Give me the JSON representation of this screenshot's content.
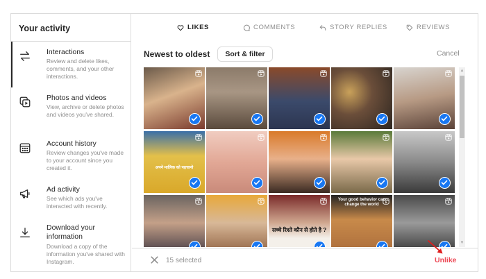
{
  "sidebar": {
    "title": "Your activity",
    "items": [
      {
        "label": "Interactions",
        "description": "Review and delete likes, comments, and your other interactions.",
        "icon": "interactions-icon"
      },
      {
        "label": "Photos and videos",
        "description": "View, archive or delete photos and videos you've shared.",
        "icon": "photos-icon"
      },
      {
        "label": "Account history",
        "description": "Review changes you've made to your account since you created it.",
        "icon": "calendar-icon"
      },
      {
        "label": "Ad activity",
        "description": "See which ads you've interacted with recently.",
        "icon": "megaphone-icon"
      },
      {
        "label": "Download your information",
        "description": "Download a copy of the information you've shared with Instagram.",
        "icon": "download-icon"
      }
    ]
  },
  "tabs": [
    {
      "label": "LIKES",
      "icon": "heart-icon",
      "active": true
    },
    {
      "label": "COMMENTS",
      "icon": "comment-icon",
      "active": false
    },
    {
      "label": "STORY REPLIES",
      "icon": "reply-icon",
      "active": false
    },
    {
      "label": "REVIEWS",
      "icon": "tag-icon",
      "active": false
    }
  ],
  "toolbar": {
    "sort_title": "Newest to oldest",
    "sort_button": "Sort & filter",
    "cancel": "Cancel"
  },
  "tiles": [
    {
      "bg": "linear-gradient(160deg,#6b5a4a 0%,#d9b38c 45%,#7a3b2e 100%)",
      "selected": true,
      "caption": ""
    },
    {
      "bg": "linear-gradient(180deg,#8c7b6a 0%,#a89684 40%,#5a4a3c 100%)",
      "selected": true,
      "caption": ""
    },
    {
      "bg": "linear-gradient(180deg,#8a4a2a 0%,#3b4a6b 55%,#2c3550 100%)",
      "selected": true,
      "caption": ""
    },
    {
      "bg": "radial-gradient(circle at 30% 40%,#c9a15a 0%,#6b4e3a 40%,#2d2620 100%)",
      "selected": true,
      "caption": ""
    },
    {
      "bg": "linear-gradient(170deg,#d8d4cf 0%,#b79a84 50%,#5a4238 100%)",
      "selected": true,
      "caption": ""
    },
    {
      "bg": "linear-gradient(180deg,#3a6fa8 0%,#e3c04a 40%,#d9a82a 100%)",
      "selected": true,
      "caption": "अपने मालिक को पहचानो"
    },
    {
      "bg": "linear-gradient(180deg,#f0ccc0 0%,#e2a896 50%,#c98a7a 100%)",
      "selected": true,
      "caption": ""
    },
    {
      "bg": "linear-gradient(180deg,#d97a2a 0%,#e8b08a 45%,#3a2a22 100%)",
      "selected": true,
      "caption": ""
    },
    {
      "bg": "linear-gradient(180deg,#5a7a3a 0%,#e8c8a8 45%,#7a6a4a 100%)",
      "selected": true,
      "caption": ""
    },
    {
      "bg": "linear-gradient(180deg,#c8c8c8 0%,#8a8a8a 50%,#3a3a3a 100%)",
      "selected": true,
      "caption": ""
    },
    {
      "bg": "linear-gradient(180deg,#6a6460 0%,#c4a088 45%,#3a3440 100%)",
      "selected": true,
      "caption": ""
    },
    {
      "bg": "linear-gradient(180deg,#e8a83a 0%,#d8b898 45%,#8a5a3a 100%)",
      "selected": true,
      "caption": ""
    },
    {
      "bg": "linear-gradient(180deg,#7a2a2a 0%,#d0a890 45%,#f4f0ea 70%,#f4f0ea 100%)",
      "selected": true,
      "caption": "सच्चे रिश्ते कौन से होते है ?"
    },
    {
      "bg": "linear-gradient(180deg,#222222 0%,#c88a4a 40%,#a86a3a 100%)",
      "selected": true,
      "caption": "Your good behavior can change the world"
    },
    {
      "bg": "linear-gradient(180deg,#4a4a4a 0%,#9a9a9a 45%,#2a2a2a 100%)",
      "selected": true,
      "caption": ""
    }
  ],
  "footer": {
    "selected_count": "15 selected",
    "unlike": "Unlike"
  },
  "colors": {
    "accent_blue": "#1877f2",
    "danger_red": "#ed4956",
    "annotation_arrow": "#e01e1e"
  }
}
